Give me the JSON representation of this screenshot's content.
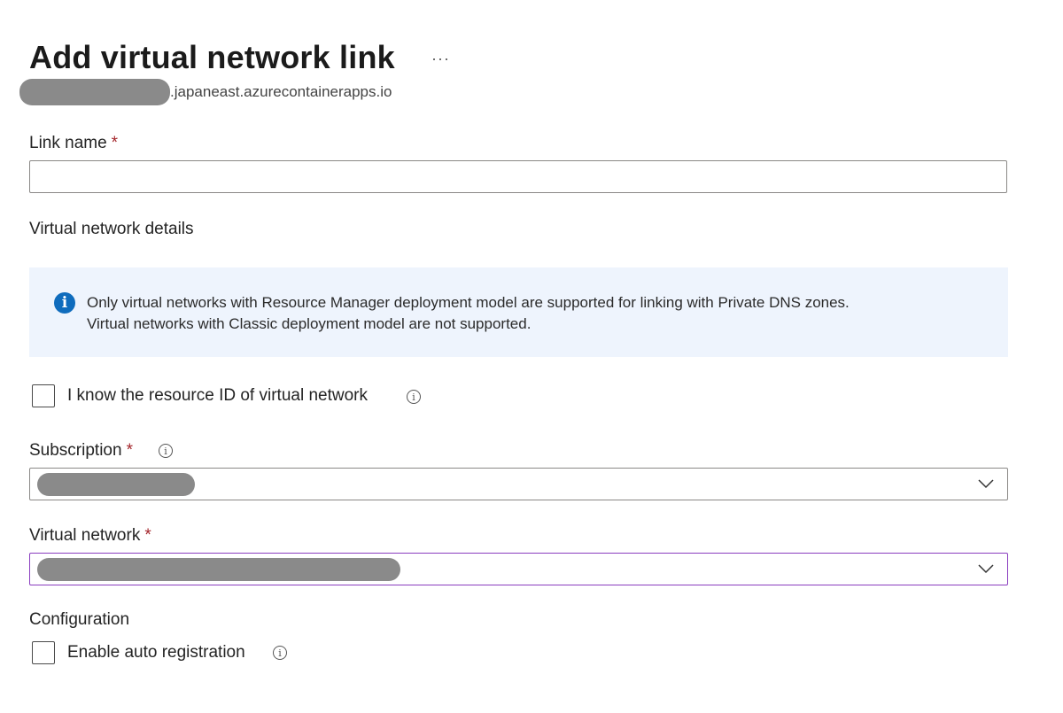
{
  "header": {
    "title": "Add virtual network link",
    "more_label": "···",
    "subtitle_suffix": ".japaneast.azurecontainerapps.io"
  },
  "link_name": {
    "label": "Link name",
    "required_mark": "*",
    "value": "",
    "placeholder": ""
  },
  "vnet_details": {
    "heading": "Virtual network details",
    "info_line1": "Only virtual networks with Resource Manager deployment model are supported for linking with Private DNS zones.",
    "info_line2": "Virtual networks with Classic deployment model are not supported."
  },
  "resource_id_checkbox": {
    "label": "I know the resource ID of virtual network",
    "checked": false
  },
  "subscription": {
    "label": "Subscription",
    "required_mark": "*"
  },
  "virtual_network": {
    "label": "Virtual network",
    "required_mark": "*"
  },
  "configuration": {
    "heading": "Configuration",
    "auto_registration_label": "Enable auto registration",
    "checked": false
  },
  "icons": {
    "info": "info-icon",
    "tooltip": "info-tooltip-icon",
    "chevron": "chevron-down-icon",
    "more": "more-options-icon"
  },
  "colors": {
    "required": "#a4262c",
    "info_bg": "#eef4fd",
    "info_icon": "#0f6cbd",
    "focus_border": "#8a3dbf"
  }
}
